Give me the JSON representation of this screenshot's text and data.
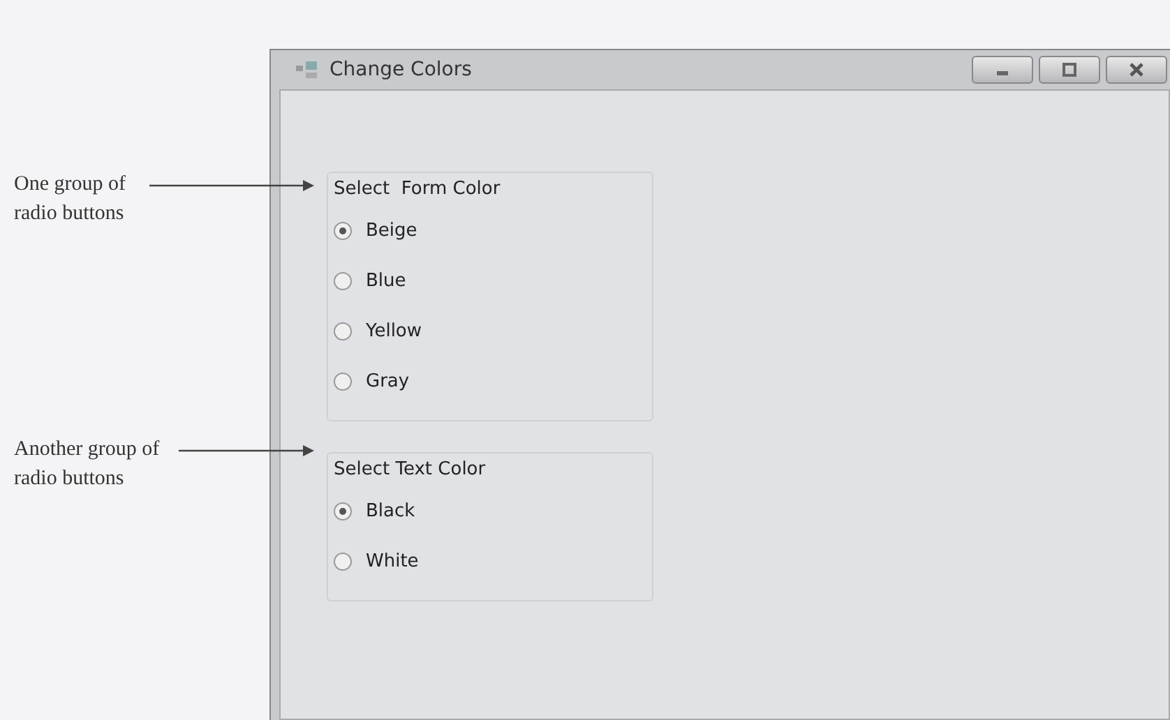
{
  "window": {
    "title": "Change Colors"
  },
  "groups": [
    {
      "caption": "Select  Form Color",
      "options": [
        {
          "label": "Beige",
          "selected": true
        },
        {
          "label": "Blue",
          "selected": false
        },
        {
          "label": "Yellow",
          "selected": false
        },
        {
          "label": "Gray",
          "selected": false
        }
      ]
    },
    {
      "caption": "Select Text Color",
      "options": [
        {
          "label": "Black",
          "selected": true
        },
        {
          "label": "White",
          "selected": false
        }
      ]
    }
  ],
  "callouts": [
    "One group of radio buttons",
    "Another group of radio buttons"
  ]
}
